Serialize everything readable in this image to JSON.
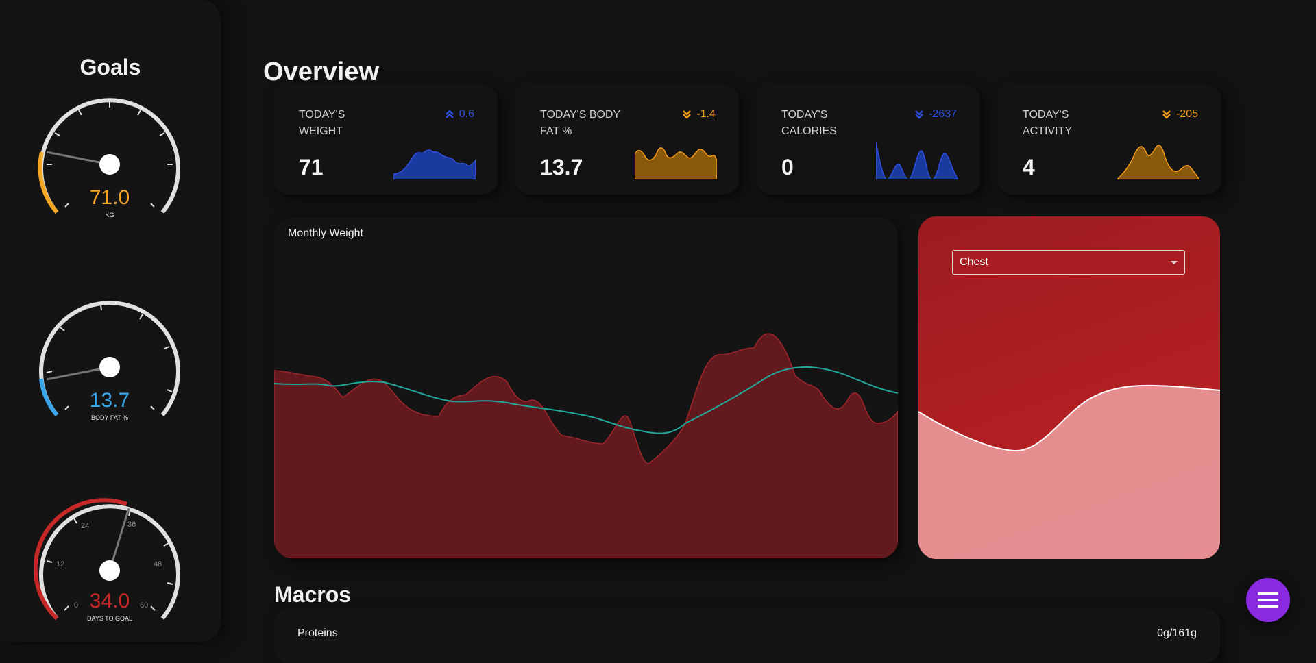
{
  "sidebar": {
    "title": "Goals",
    "gauges": [
      {
        "value": "71.0",
        "unit": "KG",
        "color": "#f5a623",
        "fill": 0.27
      },
      {
        "value": "13.7",
        "unit": "BODY FAT %",
        "color": "#3aa5e8",
        "fill": 0.12
      },
      {
        "value": "34.0",
        "unit": "DAYS TO GOAL",
        "color": "#c62828",
        "fill": 0.57,
        "ticks": [
          "0",
          "12",
          "24",
          "36",
          "48",
          "60"
        ]
      }
    ]
  },
  "overview": {
    "title": "Overview",
    "cards": [
      {
        "label": "TODAY'S WEIGHT",
        "value": "71",
        "delta": "0.6",
        "direction": "up",
        "color": "#2f4fe0",
        "fill": "#1a3aa0"
      },
      {
        "label": "TODAY'S BODY FAT %",
        "value": "13.7",
        "delta": "-1.4",
        "direction": "down",
        "color": "#f59c1a",
        "fill": "#8a5a0c"
      },
      {
        "label": "TODAY'S CALORIES",
        "value": "0",
        "delta": "-2637",
        "direction": "down",
        "color": "#2f4fe0",
        "fill": "#1a3aa0"
      },
      {
        "label": "TODAY'S ACTIVITY",
        "value": "4",
        "delta": "-205",
        "direction": "down",
        "color": "#f59c1a",
        "fill": "#8a5a0c"
      }
    ]
  },
  "monthly": {
    "title": "Monthly Weight"
  },
  "measurement": {
    "selected": "Chest"
  },
  "macros": {
    "title": "Macros",
    "rows": [
      {
        "label": "Proteins",
        "value": "0g/161g"
      }
    ]
  },
  "fab": {
    "icon": "menu-icon",
    "color": "#8a2be2"
  }
}
